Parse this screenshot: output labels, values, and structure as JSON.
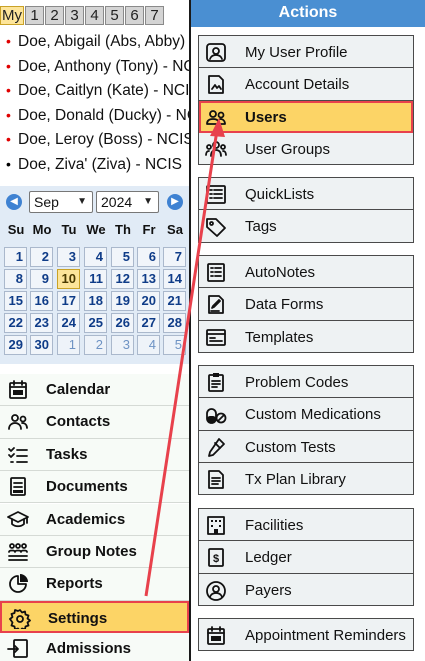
{
  "view_tabs": [
    "My",
    "1",
    "2",
    "3",
    "4",
    "5",
    "6",
    "7"
  ],
  "clients": [
    {
      "name": "Doe, Abigail (Abs, Abby)",
      "dot": "red"
    },
    {
      "name": "Doe, Anthony (Tony) - NCIS",
      "dot": "red"
    },
    {
      "name": "Doe, Caitlyn (Kate) - NCIS",
      "dot": "red"
    },
    {
      "name": "Doe, Donald (Ducky) - NCIS",
      "dot": "red"
    },
    {
      "name": "Doe, Leroy (Boss) - NCIS",
      "dot": "red"
    },
    {
      "name": "Doe, Ziva' (Ziva) - NCIS",
      "dot": "black"
    }
  ],
  "calendar": {
    "month": "Sep",
    "year": "2024",
    "weekdays": [
      "Su",
      "Mo",
      "Tu",
      "We",
      "Th",
      "Fr",
      "Sa"
    ],
    "weeks": [
      [
        "1",
        "2",
        "3",
        "4",
        "5",
        "6",
        "7"
      ],
      [
        "8",
        "9",
        "10",
        "11",
        "12",
        "13",
        "14"
      ],
      [
        "15",
        "16",
        "17",
        "18",
        "19",
        "20",
        "21"
      ],
      [
        "22",
        "23",
        "24",
        "25",
        "26",
        "27",
        "28"
      ],
      [
        "29",
        "30",
        "1",
        "2",
        "3",
        "4",
        "5"
      ]
    ],
    "today": "10"
  },
  "nav": [
    {
      "label": "Calendar",
      "icon": "calendar-icon"
    },
    {
      "label": "Contacts",
      "icon": "contacts-icon"
    },
    {
      "label": "Tasks",
      "icon": "tasks-icon"
    },
    {
      "label": "Documents",
      "icon": "documents-icon"
    },
    {
      "label": "Academics",
      "icon": "academics-icon"
    },
    {
      "label": "Group Notes",
      "icon": "group-notes-icon"
    },
    {
      "label": "Reports",
      "icon": "reports-icon"
    },
    {
      "label": "Settings",
      "icon": "settings-icon",
      "selected": true
    },
    {
      "label": "Admissions",
      "icon": "admissions-icon"
    }
  ],
  "actions": {
    "title": "Actions",
    "groups": [
      [
        {
          "label": "My User Profile",
          "icon": "user-profile-icon"
        },
        {
          "label": "Account Details",
          "icon": "account-details-icon"
        },
        {
          "label": "Users",
          "icon": "users-icon",
          "selected": true
        },
        {
          "label": "User Groups",
          "icon": "user-groups-icon"
        }
      ],
      [
        {
          "label": "QuickLists",
          "icon": "quicklists-icon"
        },
        {
          "label": "Tags",
          "icon": "tag-icon"
        }
      ],
      [
        {
          "label": "AutoNotes",
          "icon": "autonotes-icon"
        },
        {
          "label": "Data Forms",
          "icon": "data-forms-icon"
        },
        {
          "label": "Templates",
          "icon": "templates-icon"
        }
      ],
      [
        {
          "label": "Problem Codes",
          "icon": "problem-codes-icon"
        },
        {
          "label": "Custom Medications",
          "icon": "medication-icon"
        },
        {
          "label": "Custom Tests",
          "icon": "test-icon"
        },
        {
          "label": "Tx Plan Library",
          "icon": "tx-plan-icon"
        }
      ],
      [
        {
          "label": "Facilities",
          "icon": "facilities-icon"
        },
        {
          "label": "Ledger",
          "icon": "ledger-icon"
        },
        {
          "label": "Payers",
          "icon": "payers-icon"
        }
      ],
      [
        {
          "label": "Appointment Reminders",
          "icon": "calendar-icon"
        }
      ]
    ]
  },
  "colors": {
    "header_blue": "#4a8fd2",
    "highlight_yellow": "#fcd466",
    "highlight_border_red": "#e8414c",
    "calendar_bg": "#e1ebf6"
  }
}
